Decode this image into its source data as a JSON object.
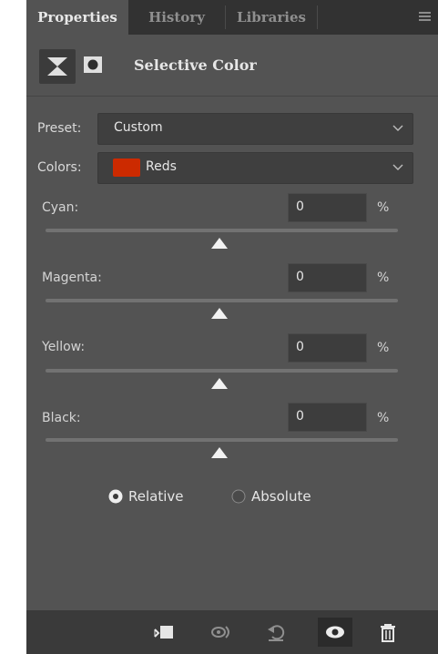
{
  "tabs": [
    {
      "label": "Properties",
      "active": true
    },
    {
      "label": "History",
      "active": false
    },
    {
      "label": "Libraries",
      "active": false
    }
  ],
  "header": {
    "title": "Selective Color",
    "icons": [
      "adjustment-layer-icon",
      "layer-mask-icon"
    ]
  },
  "preset": {
    "label": "Preset:",
    "value": "Custom"
  },
  "colors": {
    "label": "Colors:",
    "value": "Reds",
    "swatch_color": "#cc2a00"
  },
  "sliders": [
    {
      "label": "Cyan:",
      "value": "0",
      "unit": "%",
      "level": 0.5
    },
    {
      "label": "Magenta:",
      "value": "0",
      "unit": "%",
      "level": 0.5
    },
    {
      "label": "Yellow:",
      "value": "0",
      "unit": "%",
      "level": 0.5
    },
    {
      "label": "Black:",
      "value": "0",
      "unit": "%",
      "level": 0.5
    }
  ],
  "method": {
    "options": [
      {
        "label": "Relative",
        "selected": true
      },
      {
        "label": "Absolute",
        "selected": false
      }
    ]
  },
  "footer": {
    "icons": [
      "clip-to-layer-icon",
      "view-previous-state-icon",
      "reset-icon",
      "visibility-eye-icon",
      "trash-icon"
    ]
  },
  "colors_theme": {
    "panel": "#535353",
    "tabbar": "#323232",
    "accent_swatch": "#cc2a00"
  }
}
